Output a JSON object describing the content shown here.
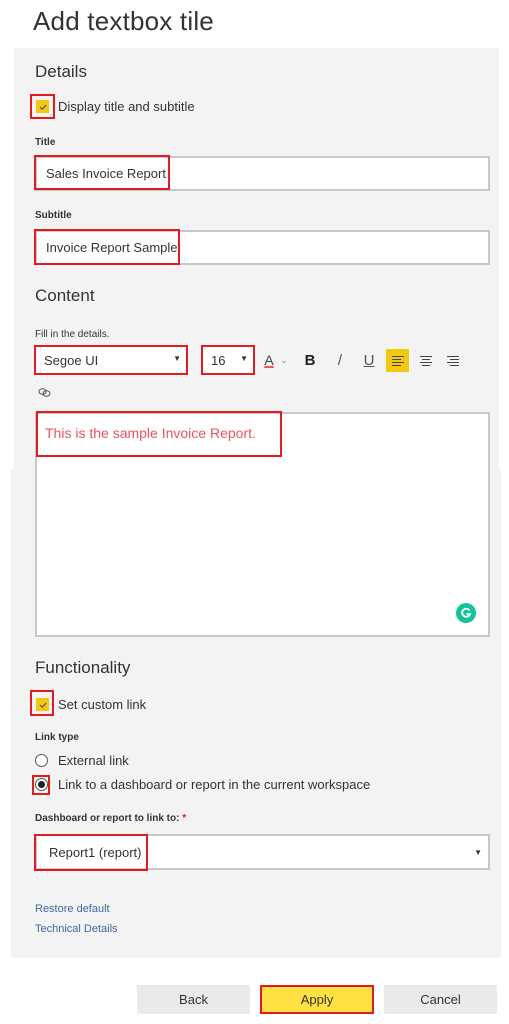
{
  "page": {
    "title": "Add textbox tile"
  },
  "details": {
    "heading": "Details",
    "display_title_checkbox": {
      "label": "Display title and subtitle",
      "checked": true
    },
    "title_label": "Title",
    "title_value": "Sales Invoice Report",
    "subtitle_label": "Subtitle",
    "subtitle_value": "Invoice Report Sample"
  },
  "content": {
    "heading": "Content",
    "hint": "Fill in the details.",
    "font_family": "Segoe UI",
    "font_size": "16",
    "toolbar": {
      "font_color_icon": "font-color-icon",
      "font_color_chevron": "chevron-down-icon",
      "bold": "B",
      "italic": "/",
      "underline": "U",
      "align_left_active": true,
      "link_icon": "link-icon"
    },
    "text": "This is the sample Invoice Report.",
    "text_color": "#e8555b",
    "grammarly_icon": "grammarly-icon"
  },
  "functionality": {
    "heading": "Functionality",
    "custom_link_checkbox": {
      "label": "Set custom link",
      "checked": true
    },
    "link_type_label": "Link type",
    "link_types": [
      {
        "label": "External link",
        "selected": false
      },
      {
        "label": "Link to a dashboard or report in the current workspace",
        "selected": true
      }
    ],
    "target_label": "Dashboard or report to link to:",
    "required_marker": "*",
    "target_value": "Report1 (report)",
    "restore_default": "Restore default",
    "technical_details": "Technical Details"
  },
  "footer": {
    "back": "Back",
    "apply": "Apply",
    "cancel": "Cancel"
  },
  "colors": {
    "accent_yellow": "#f2c811",
    "apply_yellow": "#ffe143",
    "highlight_red": "#e21b23",
    "panel_bg": "#f3f3f3",
    "link_blue": "#41679c"
  }
}
